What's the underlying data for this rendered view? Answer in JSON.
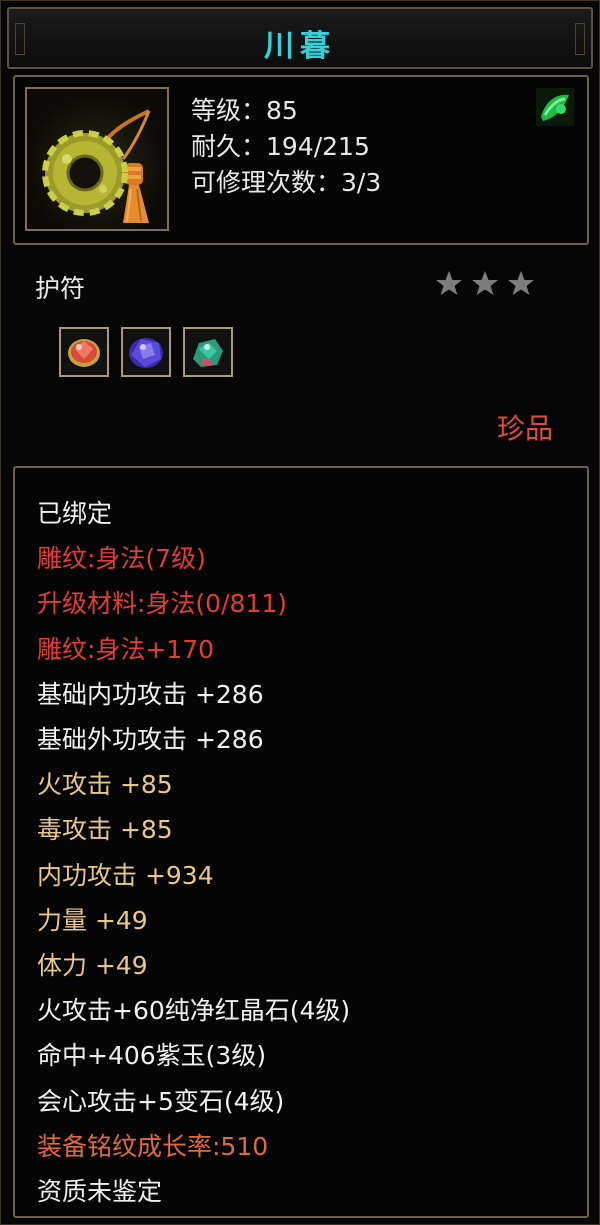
{
  "item": {
    "name": "川暮",
    "level_text": "等级：85",
    "durability_text": "耐久：194/215",
    "repair_text": "可修理次数：3/3",
    "category": "护符",
    "star_count": 3,
    "rarity": "珍品"
  },
  "sockets": [
    {
      "name": "red-crystal-gem-icon",
      "color": "#d84a3a"
    },
    {
      "name": "purple-jade-gem-icon",
      "color": "#5a4ad8"
    },
    {
      "name": "variable-stone-gem-icon",
      "color": "#3ac8a0"
    }
  ],
  "attributes": [
    {
      "text": "已绑定",
      "color": "white"
    },
    {
      "text": "雕纹:身法(7级)",
      "color": "red"
    },
    {
      "text": "升级材料:身法(0/811)",
      "color": "red"
    },
    {
      "text": "雕纹:身法+170",
      "color": "red"
    },
    {
      "text": "基础内功攻击  +286",
      "color": "white"
    },
    {
      "text": "基础外功攻击  +286",
      "color": "white"
    },
    {
      "text": "火攻击  +85",
      "color": "gold"
    },
    {
      "text": "毒攻击  +85",
      "color": "gold"
    },
    {
      "text": "内功攻击  +934",
      "color": "gold"
    },
    {
      "text": "力量  +49",
      "color": "gold"
    },
    {
      "text": "体力  +49",
      "color": "gold"
    },
    {
      "text": "火攻击+60纯净红晶石(4级)",
      "color": "white"
    },
    {
      "text": "命中+406紫玉(3级)",
      "color": "white"
    },
    {
      "text": "会心攻击+5变石(4级)",
      "color": "white"
    },
    {
      "text": "装备铭纹成长率:510",
      "color": "orange"
    },
    {
      "text": "资质未鉴定",
      "color": "white"
    }
  ],
  "colors": {
    "title": "#36d0d8",
    "red": "#e23c34",
    "gold": "#e8c889",
    "orange": "#e06a3a",
    "rarity": "#e04a3c",
    "star": "#7d7d7d"
  }
}
